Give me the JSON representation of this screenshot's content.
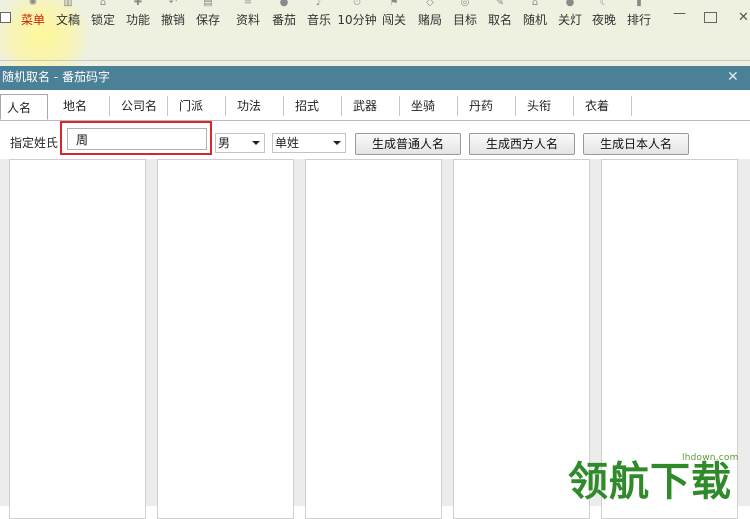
{
  "toolbar": {
    "items": [
      {
        "label": "菜单",
        "icon": "gear-icon",
        "glyph": "✺"
      },
      {
        "label": "文稿",
        "icon": "document-icon",
        "glyph": "▥"
      },
      {
        "label": "锁定",
        "icon": "lock-icon",
        "glyph": "⌂"
      },
      {
        "label": "功能",
        "icon": "plus-icon",
        "glyph": "✚"
      },
      {
        "label": "撤销",
        "icon": "undo-icon",
        "glyph": "↶"
      },
      {
        "label": "保存",
        "icon": "save-icon",
        "glyph": "▤"
      },
      {
        "label": "资料",
        "icon": "database-icon",
        "glyph": "≐"
      },
      {
        "label": "番茄",
        "icon": "tomato-icon",
        "glyph": "●"
      },
      {
        "label": "音乐",
        "icon": "music-icon",
        "glyph": "♪"
      },
      {
        "label": "10分钟",
        "icon": "timer-icon",
        "glyph": "⏱"
      },
      {
        "label": "闯关",
        "icon": "flag-icon",
        "glyph": "⚑"
      },
      {
        "label": "赌局",
        "icon": "dice-icon",
        "glyph": "◇"
      },
      {
        "label": "目标",
        "icon": "target-icon",
        "glyph": "◎"
      },
      {
        "label": "取名",
        "icon": "name-icon",
        "glyph": "✎"
      },
      {
        "label": "随机",
        "icon": "random-icon",
        "glyph": "⌂"
      },
      {
        "label": "关灯",
        "icon": "bulb-icon",
        "glyph": "●"
      },
      {
        "label": "夜晚",
        "icon": "moon-icon",
        "glyph": "☾"
      },
      {
        "label": "排行",
        "icon": "ranking-icon",
        "glyph": "▮"
      }
    ],
    "min_glyph": "—",
    "close_glyph": "✕"
  },
  "dialog": {
    "title": "随机取名 - 番茄码字",
    "close_glyph": "✕",
    "tabs": [
      "人名",
      "地名",
      "公司名",
      "门派",
      "功法",
      "招式",
      "武器",
      "坐骑",
      "丹药",
      "头衔",
      "衣着"
    ],
    "active_tab": 0,
    "surname_label": "指定姓氏",
    "surname_value": "周",
    "gender_select": "男",
    "surname_type_select": "单姓",
    "buttons": [
      "生成普通人名",
      "生成西方人名",
      "生成日本人名"
    ]
  },
  "watermark": {
    "url": "lhdown.com",
    "text": "领航下载"
  },
  "colors": {
    "title_bar": "#4b8196",
    "toolbar_bg": "#eef0e0",
    "active_label": "#cc2200",
    "highlight_box": "#d9262c",
    "watermark": "#2f8a2a"
  }
}
